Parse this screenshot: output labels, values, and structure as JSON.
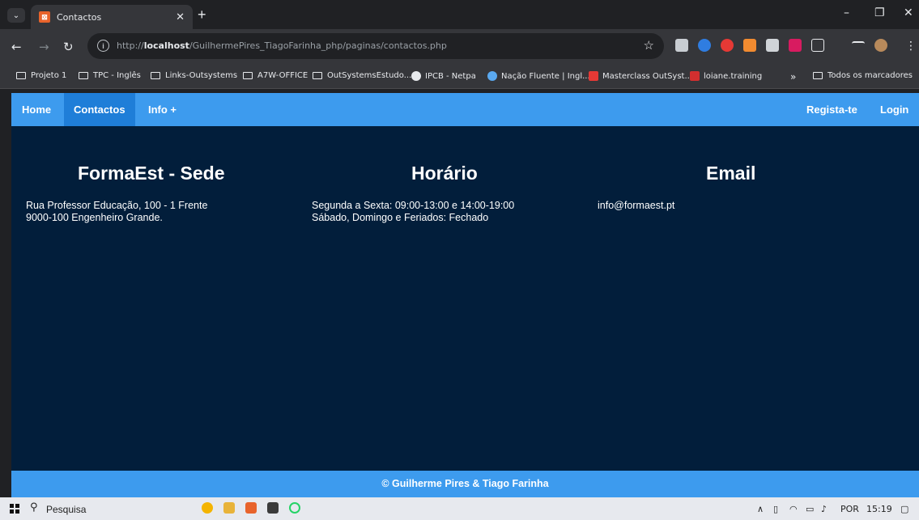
{
  "browser": {
    "tab_title": "Contactos",
    "url_prefix": "http://",
    "url_host": "localhost",
    "url_path": "/GuilhermePires_TiagoFarinha_php/paginas/contactos.php",
    "bookmarks": [
      "Projeto 1",
      "TPC - Inglês",
      "Links-Outsystems",
      "A7W-OFFICE",
      "OutSystemsEstudo...",
      "IPCB - Netpa",
      "Nação Fluente | Ingl...",
      "Masterclass OutSyst...",
      "loiane.training"
    ],
    "bookmarks_more": "»",
    "all_bookmarks": "Todos os marcadores"
  },
  "navbar": {
    "home": "Home",
    "contactos": "Contactos",
    "info": "Info +",
    "register": "Regista-te",
    "login": "Login"
  },
  "columns": {
    "sede": {
      "title": "FormaEst - Sede",
      "line1": "Rua Professor Educação, 100 - 1 Frente",
      "line2": "9000-100 Engenheiro Grande."
    },
    "horario": {
      "title": "Horário",
      "line1": "Segunda a Sexta: 09:00-13:00 e 14:00-19:00",
      "line2": "Sábado, Domingo e Feriados: Fechado"
    },
    "email": {
      "title": "Email",
      "line1": "info@formaest.pt"
    }
  },
  "footer": {
    "text": "© Guilherme Pires & Tiago Farinha"
  },
  "taskbar": {
    "search": "Pesquisa",
    "lang": "POR",
    "time": "15:19"
  },
  "colors": {
    "navbar": "#3d9bee",
    "active": "#1f7ed8",
    "page_bg": "#021e3b"
  }
}
